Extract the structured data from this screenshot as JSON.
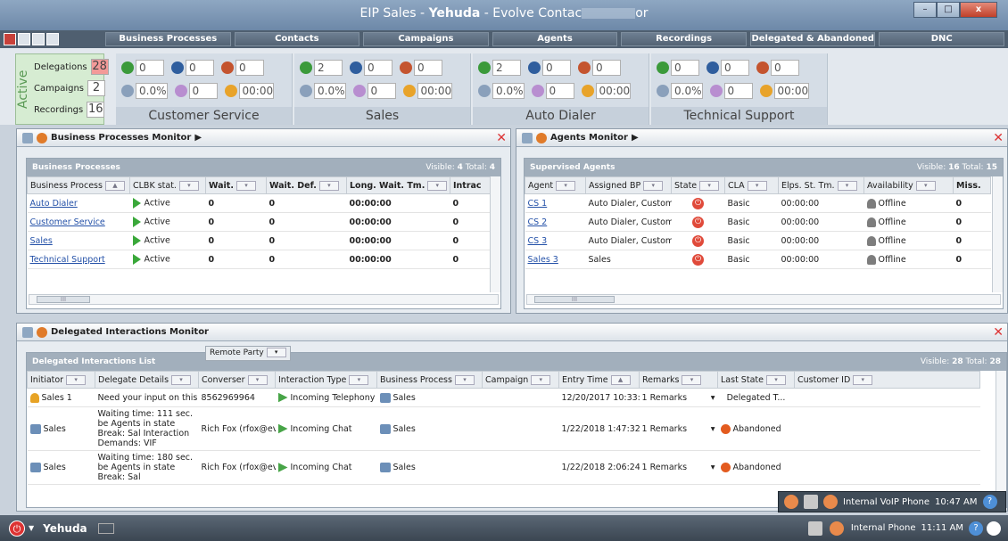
{
  "window": {
    "title_prefix": "EIP Sales - ",
    "title_user": "Yehuda",
    "title_suffix": " - Evolve Contac",
    "title_tail": "or",
    "btn_min": "–",
    "btn_max": "□",
    "btn_close": "x"
  },
  "menu": [
    "Business Processes",
    "Contacts",
    "Campaigns",
    "Agents",
    "Recordings",
    "Delegated & Abandoned",
    "DNC"
  ],
  "active": {
    "label": "Active",
    "rows": [
      {
        "label": "Delegations",
        "value": "28",
        "hot": true
      },
      {
        "label": "Campaigns",
        "value": "2",
        "hot": false
      },
      {
        "label": "Recordings",
        "value": "16",
        "hot": false
      }
    ]
  },
  "queues": [
    {
      "name": "Customer Service",
      "a": "0",
      "b": "0",
      "c": "0",
      "pct": "0.0%",
      "d": "0",
      "time": "00:00"
    },
    {
      "name": "Sales",
      "a": "2",
      "b": "0",
      "c": "0",
      "pct": "0.0%",
      "d": "0",
      "time": "00:00"
    },
    {
      "name": "Auto Dialer",
      "a": "2",
      "b": "0",
      "c": "0",
      "pct": "0.0%",
      "d": "0",
      "time": "00:00"
    },
    {
      "name": "Technical Support",
      "a": "0",
      "b": "0",
      "c": "0",
      "pct": "0.0%",
      "d": "0",
      "time": "00:00"
    }
  ],
  "bp_monitor": {
    "title": "Business Processes Monitor",
    "arrow": "▶",
    "close": "✕",
    "list_title": "Business Processes",
    "visible_label": "Visible:",
    "visible": "4",
    "total_label": "Total:",
    "total": "4",
    "columns": [
      "Business Process",
      "CLBK stat.",
      "Wait.",
      "Wait. Def.",
      "Long. Wait. Tm.",
      "Intrac"
    ],
    "rows": [
      [
        "Auto Dialer",
        "Active",
        "0",
        "0",
        "00:00:00",
        "0"
      ],
      [
        "Customer Service",
        "Active",
        "0",
        "0",
        "00:00:00",
        "0"
      ],
      [
        "Sales",
        "Active",
        "0",
        "0",
        "00:00:00",
        "0"
      ],
      [
        "Technical Support",
        "Active",
        "0",
        "0",
        "00:00:00",
        "0"
      ]
    ],
    "scroll_thumb": "III"
  },
  "agents_monitor": {
    "title": "Agents Monitor",
    "arrow": "▶",
    "close": "✕",
    "list_title": "Supervised Agents",
    "visible_label": "Visible:",
    "visible": "16",
    "total_label": "Total:",
    "total": "15",
    "columns": [
      "Agent",
      "Assigned BP",
      "State",
      "CLA",
      "Elps. St. Tm.",
      "Availability",
      "Miss."
    ],
    "rows": [
      [
        "CS 1",
        "Auto Dialer, Custome",
        "Basic",
        "00:00:00",
        "Offline",
        "0"
      ],
      [
        "CS 2",
        "Auto Dialer, Custome",
        "Basic",
        "00:00:00",
        "Offline",
        "0"
      ],
      [
        "CS 3",
        "Auto Dialer, Custome",
        "Basic",
        "00:00:00",
        "Offline",
        "0"
      ],
      [
        "Sales 3",
        "Sales",
        "Basic",
        "00:00:00",
        "Offline",
        "0"
      ]
    ],
    "scroll_thumb": "III"
  },
  "delegated": {
    "title": "Delegated Interactions Monitor",
    "close": "✕",
    "list_title": "Delegated Interactions List",
    "remote_party": "Remote Party",
    "visible_label": "Visible:",
    "visible": "28",
    "total_label": "Total:",
    "total": "28",
    "columns": [
      "Initiator",
      "Delegate Details",
      "Converser",
      "Interaction Type",
      "Business Process",
      "Campaign",
      "Entry Time",
      "Remarks",
      "Last State",
      "Customer ID"
    ],
    "rows": [
      {
        "initiator": "Sales 1",
        "details": "Need your input on this i",
        "converser": "8562969964",
        "type": "Incoming Telephony",
        "bp": "Sales",
        "entry": "12/20/2017 10:33:2",
        "remarks": "1 Remarks",
        "state": "Delegated T...",
        "abandoned": false
      },
      {
        "initiator": "Sales",
        "details": "Waiting time: 111 sec. be Agents in state Break: Sal Interaction Demands: VIF",
        "converser": "Rich Fox (rfox@evc",
        "type": "Incoming Chat",
        "bp": "Sales",
        "entry": "1/22/2018 1:47:32 I",
        "remarks": "1 Remarks",
        "state": "Abandoned",
        "abandoned": true
      },
      {
        "initiator": "Sales",
        "details": "Waiting time: 180 sec. be Agents in state Break: Sal",
        "converser": "Rich Fox (rfox@evc",
        "type": "Incoming Chat",
        "bp": "Sales",
        "entry": "1/22/2018 2:06:24 I",
        "remarks": "1 Remarks",
        "state": "Abandoned",
        "abandoned": true
      }
    ]
  },
  "phone_popup": {
    "label": "Internal VoIP Phone",
    "time": "10:47 AM",
    "help": "?"
  },
  "statusbar": {
    "power": "⏻",
    "user": "Yehuda",
    "phone_label": "Internal Phone",
    "time": "11:11 AM",
    "help": "?"
  }
}
